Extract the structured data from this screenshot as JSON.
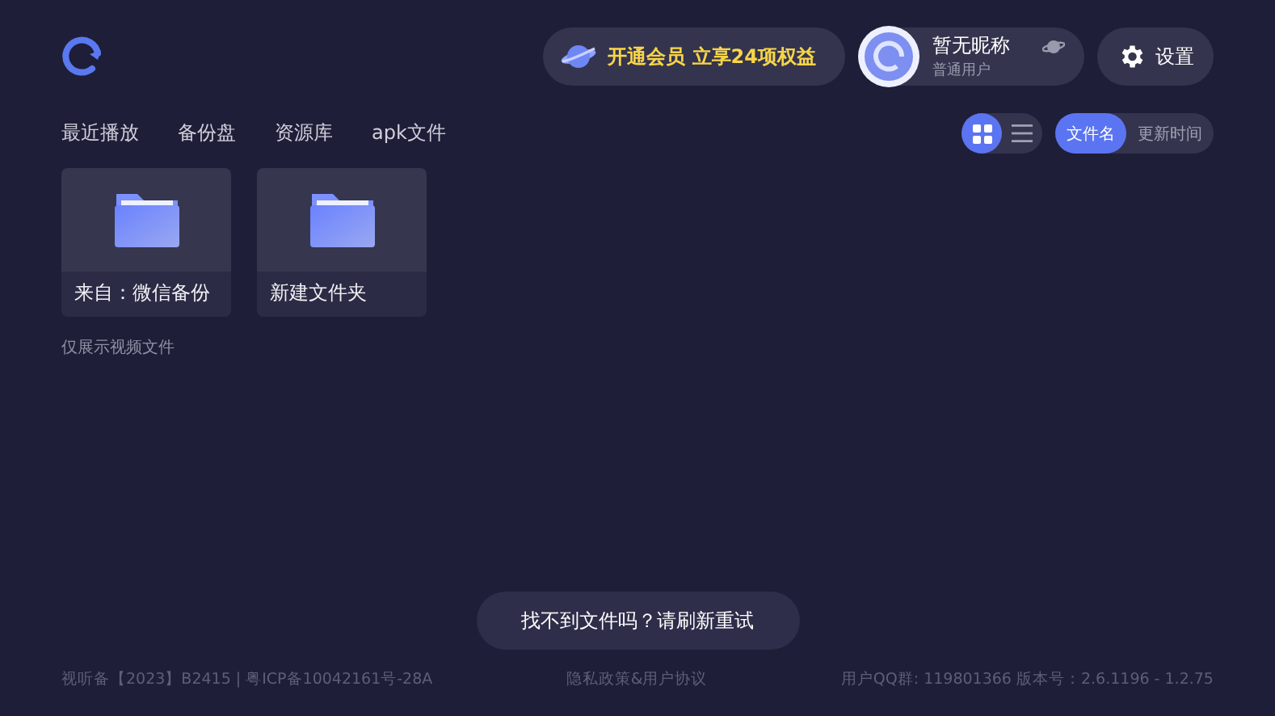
{
  "vip_banner": {
    "label": "开通会员 立享24项权益"
  },
  "user": {
    "nickname": "暂无昵称",
    "level": "普通用户"
  },
  "settings": {
    "label": "设置"
  },
  "nav": [
    {
      "label": "最近播放"
    },
    {
      "label": "备份盘"
    },
    {
      "label": "资源库"
    },
    {
      "label": "apk文件"
    }
  ],
  "view_modes": [
    {
      "kind": "grid",
      "selected": true
    },
    {
      "kind": "list",
      "selected": false
    }
  ],
  "sort": [
    {
      "label": "文件名",
      "selected": true
    },
    {
      "label": "更新时间",
      "selected": false
    }
  ],
  "folders": [
    {
      "name": "来自：微信备份"
    },
    {
      "name": "新建文件夹"
    }
  ],
  "note": "仅展示视频文件",
  "refresh_button": "找不到文件吗？请刷新重试",
  "footer": [
    "视听备【2023】B2415 | 粤ICP备10042161号-28A",
    "隐私政策&用户协议",
    "用户QQ群: 119801366 版本号：2.6.1196 - 1.2.75"
  ]
}
